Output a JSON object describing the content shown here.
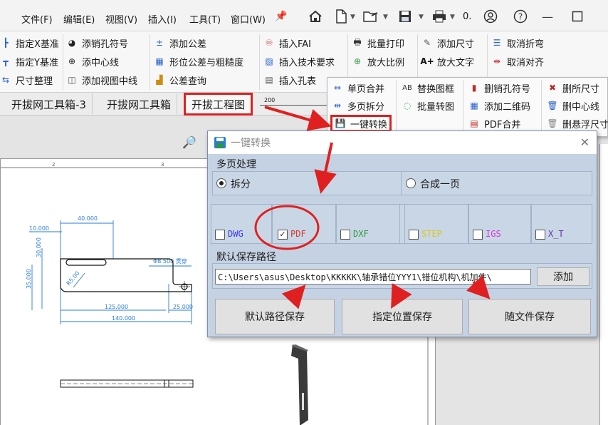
{
  "menu": {
    "file": "文件(F)",
    "edit": "编辑(E)",
    "view": "视图(V)",
    "insert": "插入(I)",
    "tools": "工具(T)",
    "window": "窗口(W)",
    "overflow": "0."
  },
  "ribbon": {
    "col1": [
      "指定X基准",
      "指定Y基准",
      "尺寸整理"
    ],
    "col2": [
      "添销孔符号",
      "添中心线",
      "添加视图中线"
    ],
    "col3": [
      "添加公差",
      "形位公差与粗糙度",
      "公差查询"
    ],
    "col4": [
      "插入FAI",
      "插入技术要求",
      "插入孔表"
    ],
    "col5": [
      "批量打印",
      "放大比例"
    ],
    "col6": [
      "添加尺寸",
      "放大文字"
    ],
    "col7": [
      "取消折弯",
      "取消对齐"
    ]
  },
  "tabs": [
    "开拔网工具箱-3",
    "开拔网工具箱",
    "开拔工程图"
  ],
  "dropdown": {
    "col1": [
      "单页合并",
      "多页拆分",
      "一键转换"
    ],
    "col2": [
      "替换图框",
      "批量转图"
    ],
    "col3": [
      "删销孔符号",
      "添加二维码",
      "PDF合并"
    ],
    "col4": [
      "删所尺寸",
      "删中心线",
      "删悬浮尺寸"
    ]
  },
  "dialog": {
    "title": "一键转换",
    "close": "✕",
    "multipage_label": "多页处理",
    "split": "拆分",
    "merge": "合成一页",
    "formats": [
      {
        "label": "DWG",
        "checked": false,
        "color": "#3a3aee"
      },
      {
        "label": "PDF",
        "checked": true,
        "color": "#d33a2c"
      },
      {
        "label": "DXF",
        "checked": false,
        "color": "#2f9a3c"
      },
      {
        "label": "STEP",
        "checked": false,
        "color": "#d8c81a"
      },
      {
        "label": "IGS",
        "checked": false,
        "color": "#d23ad2"
      },
      {
        "label": "X_T",
        "checked": false,
        "color": "#6a2fae"
      }
    ],
    "check_mark": "✓",
    "path_label": "默认保存路径",
    "path_value": "C:\\Users\\asus\\Desktop\\KKKKK\\轴承错位YYY1\\错位机构\\机加件\\",
    "add_button": "添加",
    "save_default": "默认路径保存",
    "save_specified": "指定位置保存",
    "save_with_file": "随文件保存"
  },
  "drawing": {
    "dims": [
      "40.000",
      "10.000",
      "30.000",
      "35.000",
      "Φ8.500 贯穿",
      "R5.00",
      "125.000",
      "25.000",
      "140.000"
    ],
    "ruler": [
      "200",
      "2",
      "3"
    ]
  },
  "colors": {
    "highlight_red": "#e02020",
    "dim_blue": "#2a7bd6",
    "dialog_bg": "#c5d2e3"
  }
}
